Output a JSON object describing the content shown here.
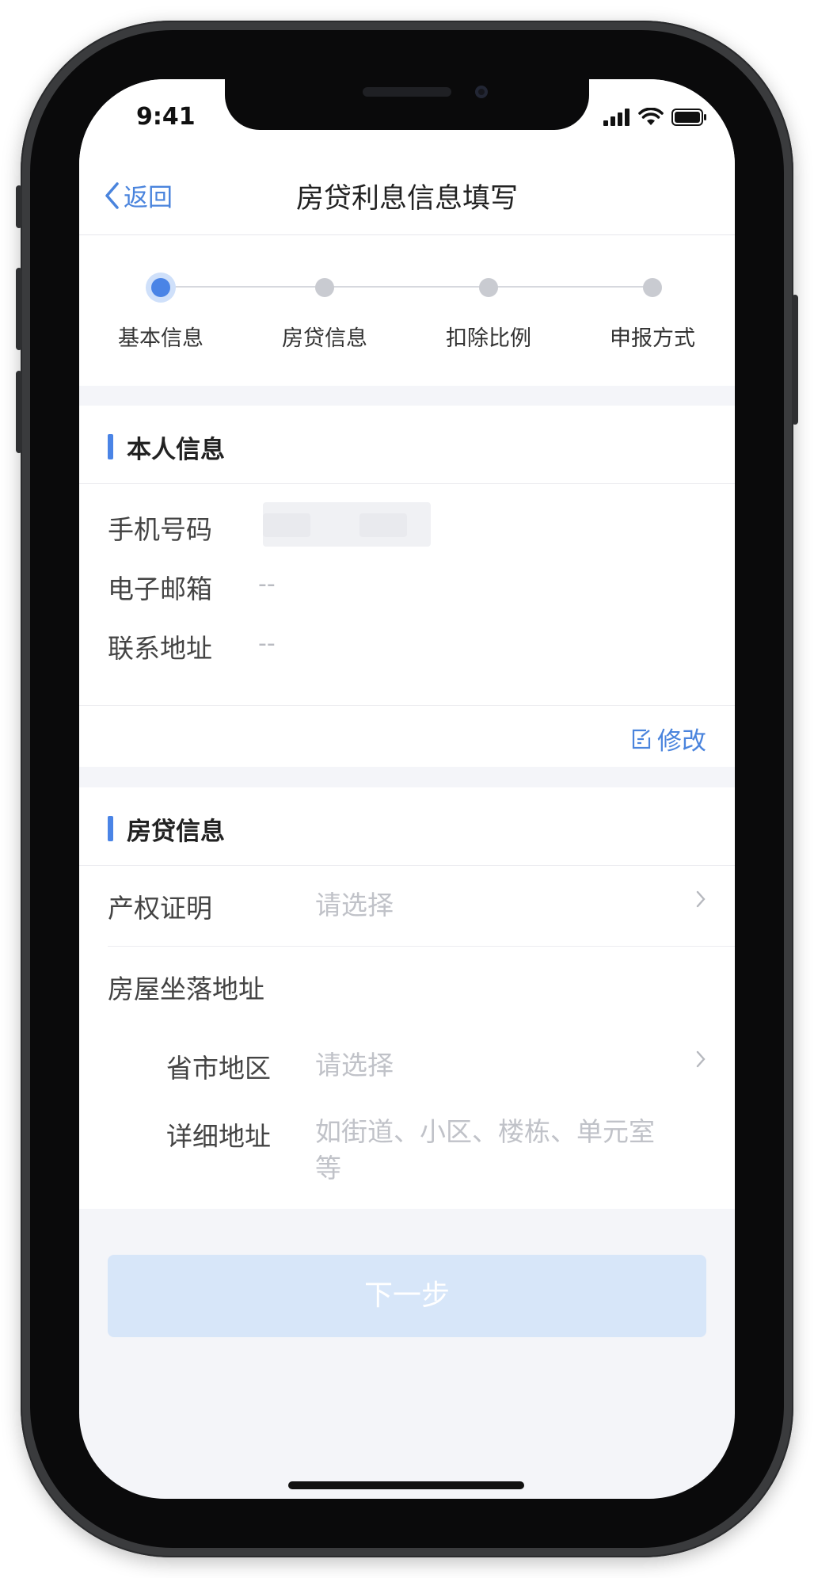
{
  "status_bar": {
    "time": "9:41"
  },
  "nav": {
    "back_label": "返回",
    "title": "房贷利息信息填写"
  },
  "stepper": {
    "steps": [
      {
        "label": "基本信息",
        "active": true
      },
      {
        "label": "房贷信息",
        "active": false
      },
      {
        "label": "扣除比例",
        "active": false
      },
      {
        "label": "申报方式",
        "active": false
      }
    ]
  },
  "personal_section": {
    "title": "本人信息",
    "rows": [
      {
        "label": "手机号码",
        "value": ""
      },
      {
        "label": "电子邮箱",
        "value": "--"
      },
      {
        "label": "联系地址",
        "value": "--"
      }
    ],
    "edit_label": "修改"
  },
  "loan_section": {
    "title": "房贷信息",
    "property_cert": {
      "label": "产权证明",
      "placeholder": "请选择"
    },
    "address_heading": "房屋坐落地址",
    "region": {
      "label": "省市地区",
      "placeholder": "请选择"
    },
    "detail": {
      "label": "详细地址",
      "placeholder_line1": "如街道、小区、楼栋、单元室",
      "placeholder_line2": "等"
    }
  },
  "footer": {
    "next_label": "下一步"
  },
  "colors": {
    "accent": "#4a84e6",
    "button_disabled": "#d7e6f9",
    "page_bg": "#f4f5f9"
  }
}
